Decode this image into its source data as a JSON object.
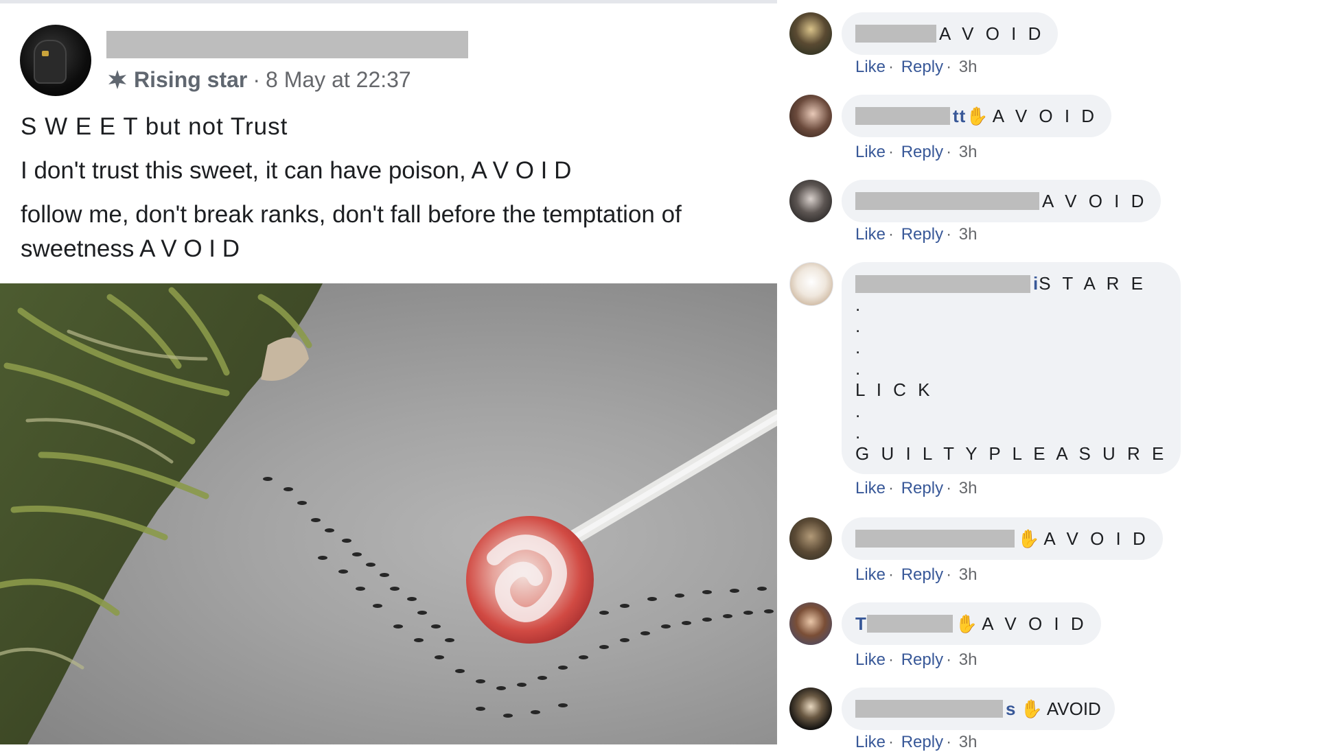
{
  "post": {
    "badge_label": "Rising star",
    "meta_separator": "·",
    "timestamp": "8 May at 22:37",
    "paragraphs": [
      "S W E E T but not Trust",
      "I don't trust this sweet, it can have poison, A V O I D",
      "follow me, don't break ranks, don't fall before the temptation of sweetness A V O I D"
    ]
  },
  "comments": [
    {
      "name_fragment": "",
      "text": "A V O I D",
      "like": "Like",
      "reply": "Reply",
      "time": "3h"
    },
    {
      "name_fragment": "tt",
      "text": "A V O I D",
      "like": "Like",
      "reply": "Reply",
      "time": "3h"
    },
    {
      "name_fragment": "",
      "text": "A V O I D",
      "like": "Like",
      "reply": "Reply",
      "time": "3h"
    },
    {
      "name_fragment": "i",
      "lines": [
        "S T A R E",
        ".",
        ".",
        ".",
        ".",
        "L I C K",
        ".",
        ".",
        "G U I L T Y P L E A S U R E"
      ],
      "like": "Like",
      "reply": "Reply",
      "time": "3h"
    },
    {
      "name_fragment": "",
      "text": "A V O I D",
      "like": "Like",
      "reply": "Reply",
      "time": "3h"
    },
    {
      "name_fragment": "T",
      "text": "A V O I D",
      "like": "Like",
      "reply": "Reply",
      "time": "3h"
    },
    {
      "name_fragment": "s",
      "text": "AVOID",
      "like": "Like",
      "reply": "Reply",
      "time": "3h"
    }
  ],
  "icons": {
    "badge": "rising-star-icon",
    "hand": "waving-hand-icon"
  },
  "colors": {
    "link": "#385898",
    "meta": "#65676b",
    "bubble": "#f0f2f5",
    "redaction": "#bdbdbd"
  }
}
